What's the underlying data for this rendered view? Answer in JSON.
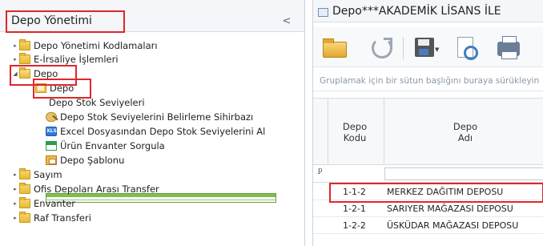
{
  "left_panel": {
    "title": "Depo Yönetimi",
    "collapse_glyph": "<",
    "tree": [
      {
        "label": "Depo Yönetimi Kodlamaları",
        "icon": "folder-icon",
        "arrow": "▸"
      },
      {
        "label": "E-İrsaliye İşlemleri",
        "icon": "folder-icon",
        "arrow": "▸"
      },
      {
        "label": "Depo",
        "icon": "folder-open-icon",
        "arrow": "◢"
      },
      {
        "label": "Depo",
        "icon": "depo-icon",
        "arrow": ""
      },
      {
        "label": "Depo Stok Seviyeleri",
        "icon": "grid-icon",
        "arrow": ""
      },
      {
        "label": "Depo Stok Seviyelerini Belirleme Sihirbazı",
        "icon": "wizard-icon",
        "arrow": ""
      },
      {
        "label": "Excel Dosyasından Depo Stok Seviyelerini Al",
        "icon": "excel-icon",
        "arrow": ""
      },
      {
        "label": "Ürün Envanter Sorgula",
        "icon": "inventory-icon",
        "arrow": ""
      },
      {
        "label": "Depo Şablonu",
        "icon": "template-icon",
        "arrow": ""
      },
      {
        "label": "Sayım",
        "icon": "folder-icon",
        "arrow": "▸"
      },
      {
        "label": "Ofis Depoları Arası Transfer",
        "icon": "folder-icon",
        "arrow": "▸"
      },
      {
        "label": "Envanter",
        "icon": "folder-icon",
        "arrow": "▸"
      },
      {
        "label": "Raf Transferi",
        "icon": "folder-icon",
        "arrow": "▸"
      }
    ]
  },
  "right_panel": {
    "title": "Depo***AKADEMİK LİSANS İLE",
    "toolbar": {
      "open": "open-folder-icon",
      "refresh": "refresh-icon",
      "save": "save-icon",
      "preview": "print-preview-icon",
      "print": "print-icon"
    },
    "group_hint": "Gruplamak için bir sütun başlığını buraya sürükleyin",
    "columns": [
      {
        "line1": "Depo",
        "line2": "Kodu"
      },
      {
        "line1": "Depo",
        "line2": "Adı"
      }
    ],
    "filter_pin": "ꝑ",
    "rows": [
      {
        "code": "1-1-2",
        "name": "MERKEZ DAĞITIM DEPOSU"
      },
      {
        "code": "1-2-1",
        "name": "SARIYER MAĞAZASI DEPOSU"
      },
      {
        "code": "1-2-2",
        "name": "ÜSKÜDAR MAĞAZASI DEPOSU"
      }
    ]
  },
  "colors": {
    "highlight": "#e0262b",
    "panel_header": "#f4f6f9",
    "grid_border": "#d5dce4"
  }
}
